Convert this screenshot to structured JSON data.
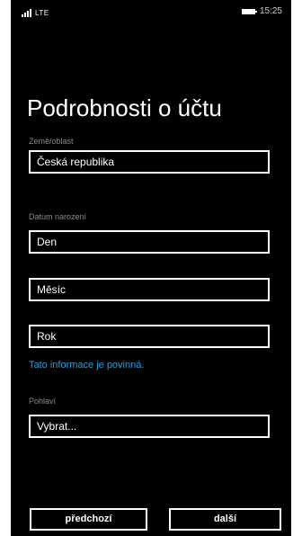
{
  "status_bar": {
    "network": "LTE",
    "time": "15:25"
  },
  "page_title": "Podrobnosti o účtu",
  "country": {
    "label": "Země/oblast",
    "value": "Česká republika"
  },
  "birthdate": {
    "label": "Datum narození",
    "day": "Den",
    "month": "Měsíc",
    "year": "Rok",
    "note": "Tato informace je povinná."
  },
  "gender": {
    "label": "Pohlaví",
    "value": "Vybrat..."
  },
  "buttons": {
    "previous": "předchozí",
    "next": "další"
  },
  "colors": {
    "background": "#000000",
    "accent": "#1aa1e1",
    "label": "#8a8a8a"
  }
}
